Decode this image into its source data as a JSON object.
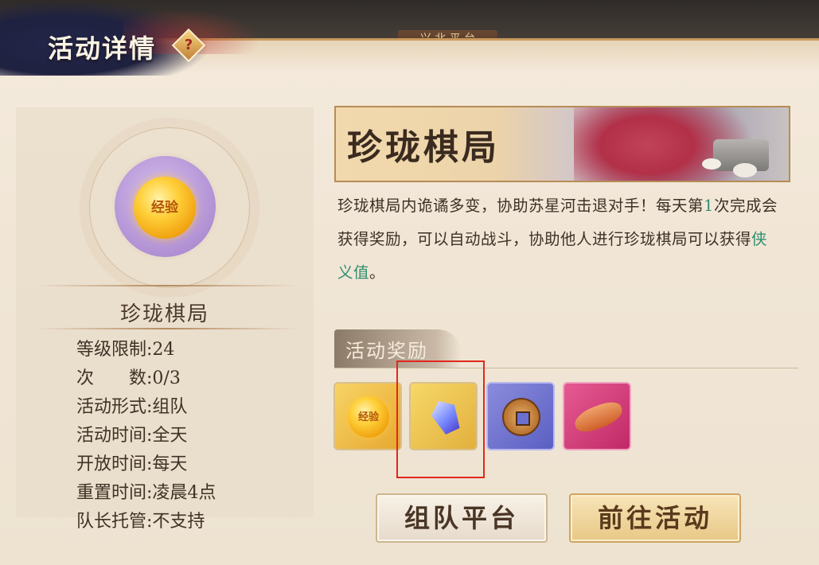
{
  "header": {
    "title": "活动详情",
    "help_icon_glyph": "?",
    "background_tab": "兴 北 平 台"
  },
  "activity": {
    "name": "珍珑棋局",
    "emblem_text": "经验",
    "info": [
      {
        "label": "等级限制:",
        "value": "24"
      },
      {
        "label": "次　　数:",
        "value": "0/3"
      },
      {
        "label": "活动形式:",
        "value": "组队"
      },
      {
        "label": "活动时间:",
        "value": "全天"
      },
      {
        "label": "开放时间:",
        "value": "每天"
      },
      {
        "label": "重置时间:",
        "value": "凌晨4点"
      },
      {
        "label": "队长托管:",
        "value": "不支持"
      }
    ]
  },
  "banner": {
    "title": "珍珑棋局"
  },
  "description": {
    "part1": "珍珑棋局内诡谲多变，协助苏星河击退对手！每天第",
    "highlight_count": "1",
    "part2": "次完成会获得奖励，可以自动战斗，协助他人进行珍珑棋局可以获得",
    "highlight_reward": "侠义值",
    "part3": "。"
  },
  "rewards": {
    "title": "活动奖励",
    "items": [
      {
        "icon": "experience-coin-icon",
        "text": "经验"
      },
      {
        "icon": "crystal-icon",
        "text": ""
      },
      {
        "icon": "copper-coin-icon",
        "text": ""
      },
      {
        "icon": "dried-fish-icon",
        "text": ""
      }
    ]
  },
  "buttons": {
    "team": "组队平台",
    "go": "前往活动"
  },
  "colors": {
    "highlight_box": "#e0281c",
    "accent_text": "#2f8e6e"
  }
}
